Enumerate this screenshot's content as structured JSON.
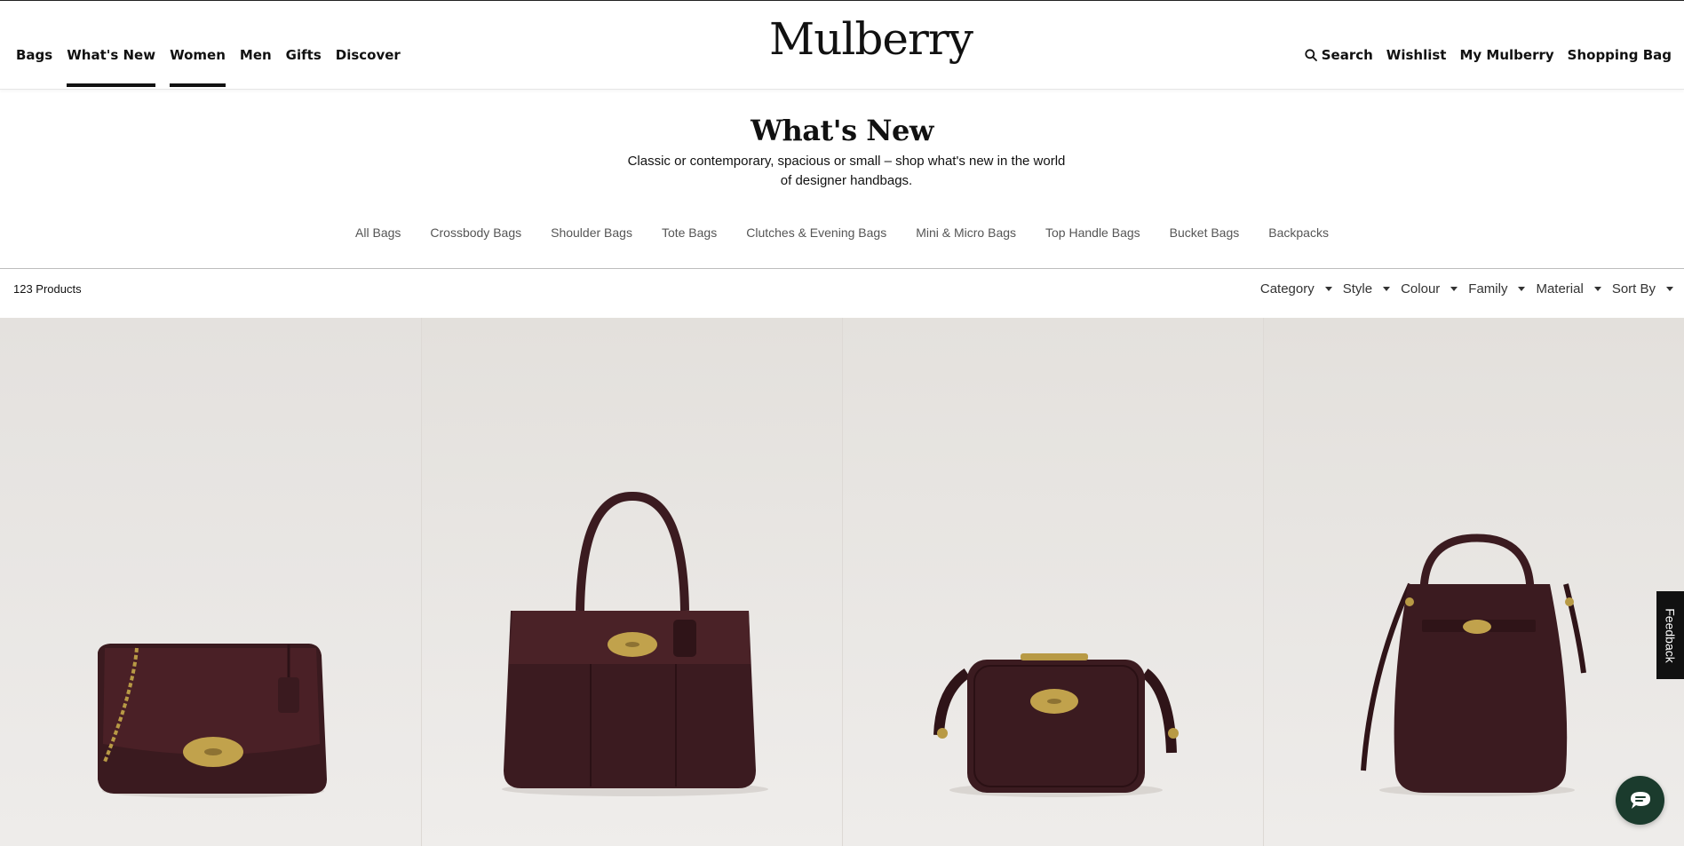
{
  "header": {
    "logo": "Mulberry",
    "nav_left": [
      "Bags",
      "What's New",
      "Women",
      "Men",
      "Gifts",
      "Discover"
    ],
    "nav_right": {
      "search": "Search",
      "wishlist": "Wishlist",
      "account": "My Mulberry",
      "bag": "Shopping Bag"
    }
  },
  "page": {
    "title": "What's New",
    "description": "Classic or contemporary, spacious or small – shop what's new in the world of designer handbags."
  },
  "categories": [
    "All Bags",
    "Crossbody Bags",
    "Shoulder Bags",
    "Tote Bags",
    "Clutches & Evening Bags",
    "Mini & Micro Bags",
    "Top Handle Bags",
    "Bucket Bags",
    "Backpacks"
  ],
  "results": {
    "count": "123 Products",
    "filters": [
      "Category",
      "Style",
      "Colour",
      "Family",
      "Material",
      "Sort By"
    ]
  },
  "products": [
    {
      "image": "oxblood-chain-shoulder-bag"
    },
    {
      "image": "oxblood-bayswater-tote"
    },
    {
      "image": "oxblood-camera-crossbody"
    },
    {
      "image": "oxblood-bucket-bag"
    }
  ],
  "feedback": "Feedback",
  "colors": {
    "text": "#111111",
    "muted": "#555555",
    "image_bg": "#e8e5e1",
    "leather": "#3b1c20",
    "hardware": "#b89a45",
    "chat": "#1b3b2d"
  },
  "icons": [
    "search-icon",
    "chat-icon",
    "caret-down-icon"
  ]
}
